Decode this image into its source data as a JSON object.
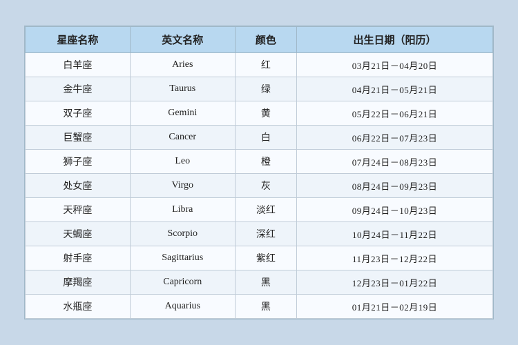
{
  "table": {
    "headers": [
      "星座名称",
      "英文名称",
      "颜色",
      "出生日期（阳历）"
    ],
    "rows": [
      [
        "白羊座",
        "Aries",
        "红",
        "03月21日－04月20日"
      ],
      [
        "金牛座",
        "Taurus",
        "绿",
        "04月21日－05月21日"
      ],
      [
        "双子座",
        "Gemini",
        "黄",
        "05月22日－06月21日"
      ],
      [
        "巨蟹座",
        "Cancer",
        "白",
        "06月22日－07月23日"
      ],
      [
        "狮子座",
        "Leo",
        "橙",
        "07月24日－08月23日"
      ],
      [
        "处女座",
        "Virgo",
        "灰",
        "08月24日－09月23日"
      ],
      [
        "天秤座",
        "Libra",
        "淡红",
        "09月24日－10月23日"
      ],
      [
        "天蝎座",
        "Scorpio",
        "深红",
        "10月24日－11月22日"
      ],
      [
        "射手座",
        "Sagittarius",
        "紫红",
        "11月23日－12月22日"
      ],
      [
        "摩羯座",
        "Capricorn",
        "黑",
        "12月23日－01月22日"
      ],
      [
        "水瓶座",
        "Aquarius",
        "黑",
        "01月21日－02月19日"
      ]
    ]
  }
}
